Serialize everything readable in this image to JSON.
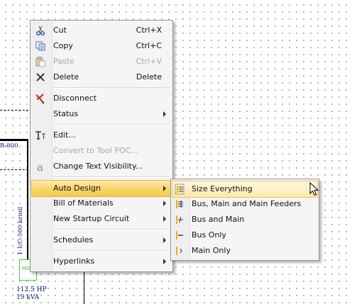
{
  "canvas": {
    "bus_label": "B-800",
    "cable_label": "1-1/C-500 kcmil",
    "motor_label": "MO",
    "motor_rating_hp": "112.5 HP",
    "motor_rating_kva": "19 kVA"
  },
  "context_menu": {
    "items": [
      {
        "label": "Cut",
        "shortcut": "Ctrl+X",
        "icon": "scissors-icon"
      },
      {
        "label": "Copy",
        "shortcut": "Ctrl+C",
        "icon": "copy-icon"
      },
      {
        "label": "Paste",
        "shortcut": "Ctrl+V",
        "icon": "paste-icon",
        "disabled": true
      },
      {
        "label": "Delete",
        "shortcut": "Delete",
        "icon": "delete-x-icon"
      },
      {
        "label": "Disconnect",
        "icon": "disconnect-cutter-icon"
      },
      {
        "label": "Status",
        "submenu": true
      },
      {
        "label": "Edit...",
        "icon": "edit-text-tool-icon"
      },
      {
        "label": "Convert to Tool POC...",
        "disabled": true
      },
      {
        "label": "Change Text Visibility...",
        "icon": "text-visibility-icon"
      },
      {
        "label": "Auto Design",
        "submenu": true,
        "highlighted": true
      },
      {
        "label": "Bill of Materials",
        "submenu": true
      },
      {
        "label": "New Startup Circuit",
        "submenu": true
      },
      {
        "label": "Schedules",
        "submenu": true
      },
      {
        "label": "Hyperlinks",
        "submenu": true
      }
    ]
  },
  "auto_design_submenu": {
    "items": [
      {
        "label": "Size Everything",
        "icon": "size-everything-icon",
        "highlighted": true
      },
      {
        "label": "Bus, Main and Main Feeders",
        "icon": "bus-main-feeders-icon"
      },
      {
        "label": "Bus and Main",
        "icon": "bus-and-main-icon"
      },
      {
        "label": "Bus Only",
        "icon": "bus-only-icon"
      },
      {
        "label": "Main Only",
        "icon": "main-only-icon"
      }
    ]
  },
  "colors": {
    "highlight": "#f8c94a",
    "menu_background": "#f5f5f5",
    "cad_text": "#0a1a6e",
    "motor_outline": "#3bd23b"
  }
}
